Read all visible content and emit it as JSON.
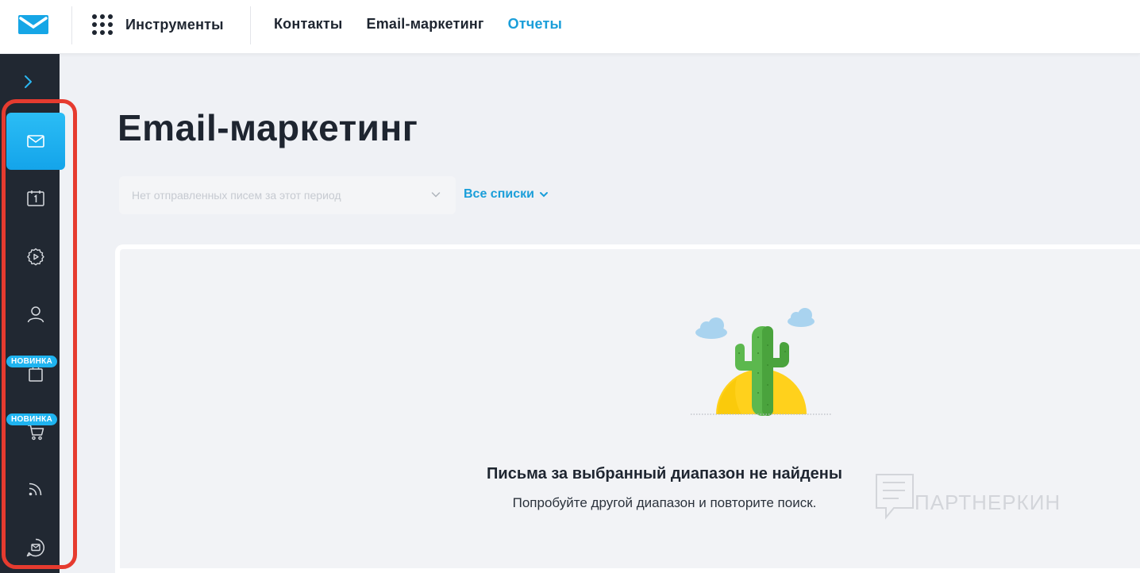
{
  "header": {
    "tools_label": "Инструменты",
    "nav": [
      {
        "label": "Контакты",
        "active": false
      },
      {
        "label": "Email-маркетинг",
        "active": false
      },
      {
        "label": "Отчеты",
        "active": true
      }
    ]
  },
  "sidebar": {
    "items": [
      {
        "icon": "envelope-icon",
        "active": true
      },
      {
        "icon": "calendar-icon",
        "active": false
      },
      {
        "icon": "automation-gear-icon",
        "active": false
      },
      {
        "icon": "user-icon",
        "active": false
      },
      {
        "icon": "shopping-bag-icon",
        "badge": "НОВИНКА",
        "active": false
      },
      {
        "icon": "cart-icon",
        "badge": "НОВИНКА",
        "active": false
      },
      {
        "icon": "rss-icon",
        "active": false
      },
      {
        "icon": "chat-mail-icon",
        "active": false
      }
    ]
  },
  "main": {
    "title": "Email-маркетинг",
    "period_select_placeholder": "Нет отправленных писем за этот период",
    "lists_link": "Все списки",
    "empty_state": {
      "title": "Письма за выбранный диапазон не найдены",
      "subtitle": "Попробуйте другой диапазон и повторите поиск."
    }
  },
  "watermark": "ПАРТНЕРКИН",
  "colors": {
    "accent": "#1a9ed9",
    "sidebar": "#212832",
    "active_item": "#14a4ea",
    "highlight_border": "#e63b2f",
    "background": "#eff1f5"
  }
}
